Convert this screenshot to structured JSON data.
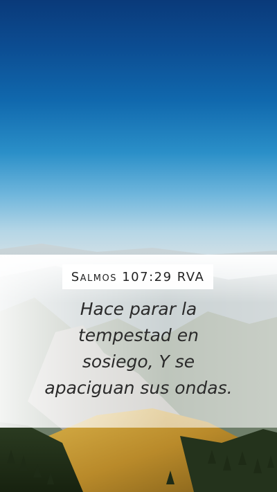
{
  "reference": "Salmos 107:29 RVA",
  "verse_lines": [
    "Hace parar la",
    "tempestad en",
    "sosiego, Y se",
    "apaciguan sus ondas."
  ]
}
